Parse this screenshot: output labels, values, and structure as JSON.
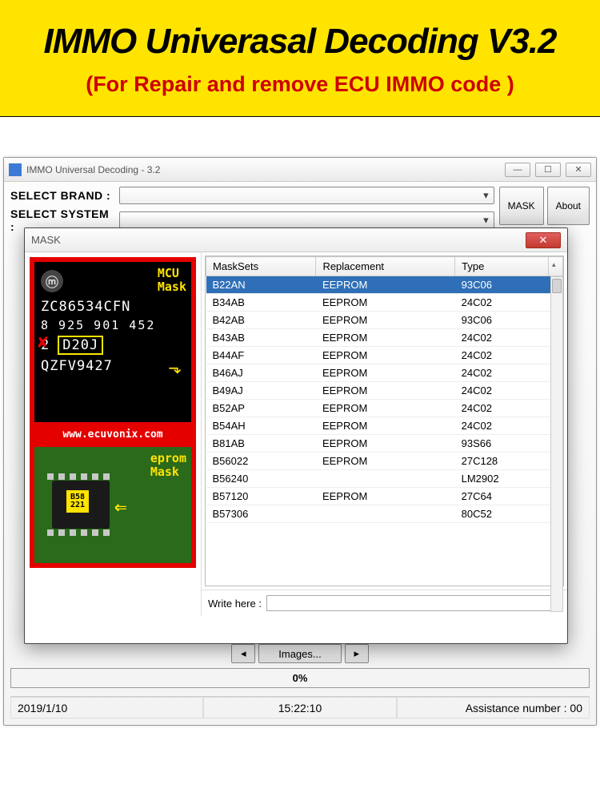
{
  "banner": {
    "title": "IMMO Univerasal Decoding V3.2",
    "subtitle": "(For Repair and remove ECU IMMO code )"
  },
  "main_window": {
    "title": "IMMO Universal Decoding - 3.2",
    "labels": {
      "select_brand": "SELECT BRAND :",
      "select_system": "SELECT SYSTEM :"
    },
    "buttons": {
      "mask": "MASK",
      "about": "About",
      "images": "Images...",
      "prev": "◂",
      "next": "▸"
    },
    "progress_text": "0%",
    "status": {
      "date": "2019/1/10",
      "time": "15:22:10",
      "assist": "Assistance number : 00"
    }
  },
  "mask_window": {
    "title": "MASK",
    "chip": {
      "mcu_label_1": "MCU",
      "mcu_label_2": "Mask",
      "line1": "ZC86534CFN",
      "line2": "8  925  901  452",
      "line3_strike": "2",
      "line3_box": "D20J",
      "line4": "QZFV9427",
      "url": "www.ecuvonix.com",
      "eprom_label_1": "eprom",
      "eprom_label_2": "Mask",
      "ic_mark_1": "B58",
      "ic_mark_2": "221"
    },
    "grid": {
      "headers": {
        "c1": "MaskSets",
        "c2": "Replacement",
        "c3": "Type"
      },
      "rows": [
        {
          "maskset": "B22AN",
          "replacement": "EEPROM",
          "type": "93C06",
          "selected": true
        },
        {
          "maskset": "B34AB",
          "replacement": "EEPROM",
          "type": "24C02"
        },
        {
          "maskset": "B42AB",
          "replacement": "EEPROM",
          "type": "93C06"
        },
        {
          "maskset": "B43AB",
          "replacement": "EEPROM",
          "type": "24C02"
        },
        {
          "maskset": "B44AF",
          "replacement": "EEPROM",
          "type": "24C02"
        },
        {
          "maskset": "B46AJ",
          "replacement": "EEPROM",
          "type": "24C02"
        },
        {
          "maskset": "B49AJ",
          "replacement": "EEPROM",
          "type": "24C02"
        },
        {
          "maskset": "B52AP",
          "replacement": "EEPROM",
          "type": "24C02"
        },
        {
          "maskset": "B54AH",
          "replacement": "EEPROM",
          "type": "24C02"
        },
        {
          "maskset": "B81AB",
          "replacement": "EEPROM",
          "type": "93S66"
        },
        {
          "maskset": "B56022",
          "replacement": "EEPROM",
          "type": "27C128"
        },
        {
          "maskset": "B56240",
          "replacement": "",
          "type": "LM2902"
        },
        {
          "maskset": "B57120",
          "replacement": "EEPROM",
          "type": "27C64"
        },
        {
          "maskset": "B57306",
          "replacement": "",
          "type": "80C52"
        }
      ]
    },
    "write_label": "Write here :",
    "write_value": ""
  }
}
